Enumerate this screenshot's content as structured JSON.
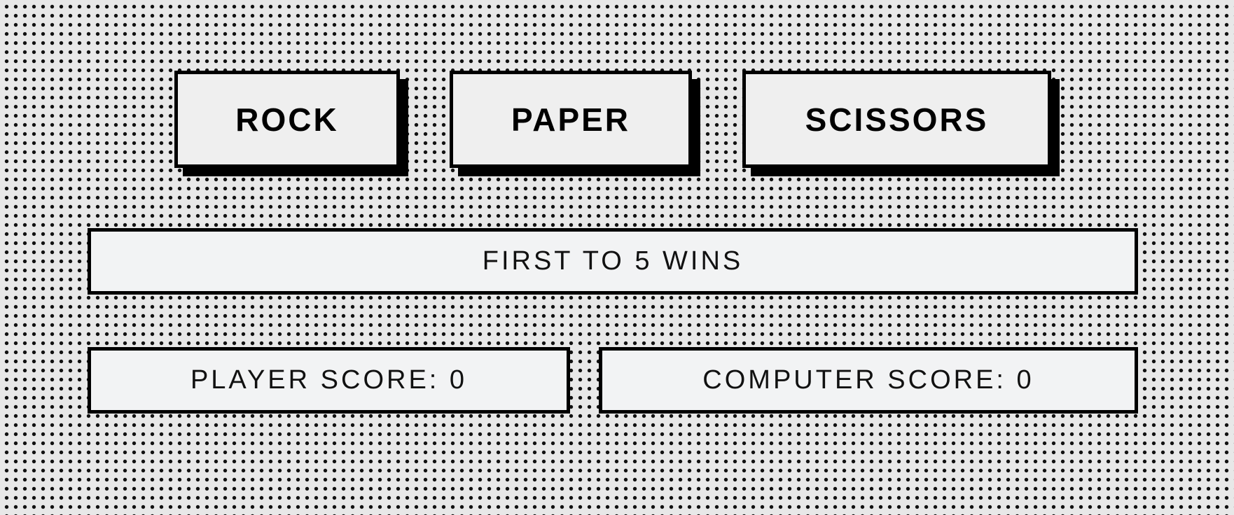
{
  "choices": {
    "rock": "ROCK",
    "paper": "PAPER",
    "scissors": "SCISSORS"
  },
  "message": "FIRST TO 5 WINS",
  "scores": {
    "player_label": "PLAYER SCORE: ",
    "player_value": "0",
    "computer_label": "COMPUTER SCORE: ",
    "computer_value": "0"
  }
}
